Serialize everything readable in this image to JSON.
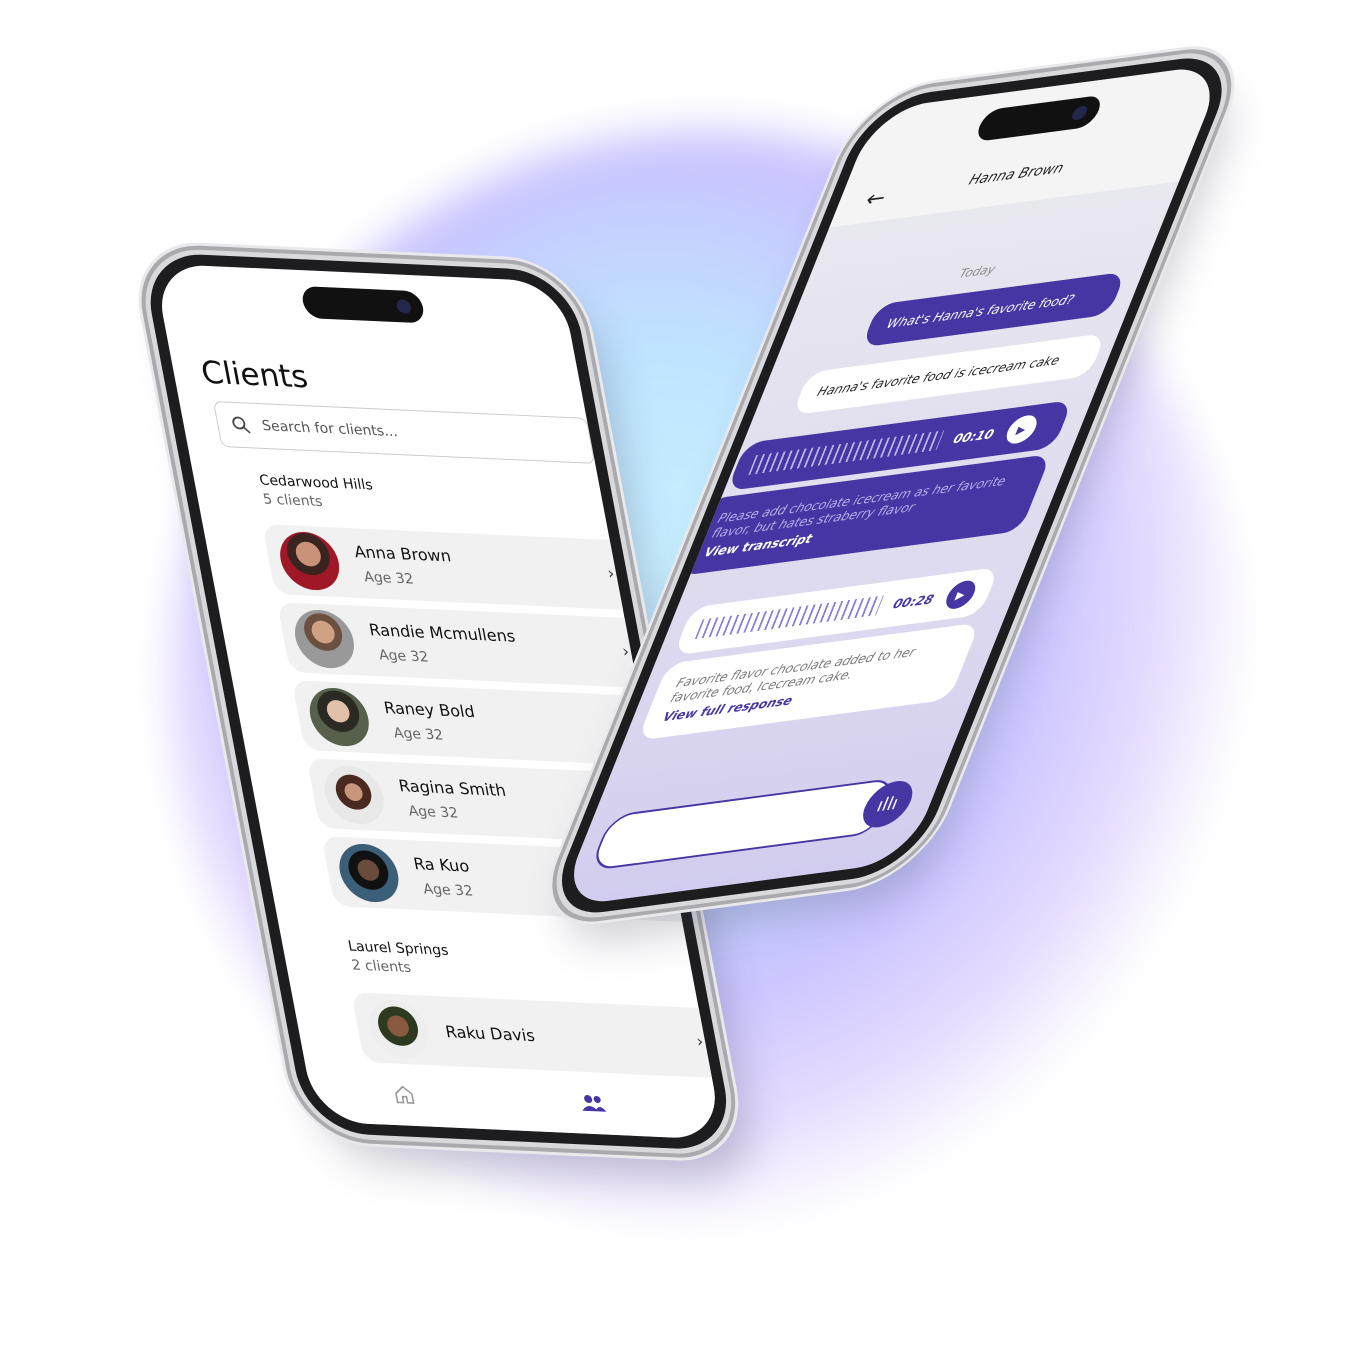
{
  "colors": {
    "accent": "#4536a3",
    "row_bg": "#f1f1f2"
  },
  "clients": {
    "title": "Clients",
    "search_placeholder": "Search for clients...",
    "groups": [
      {
        "name": "Cedarwood Hills",
        "count": "5 clients",
        "clients": [
          {
            "name": "Anna Brown",
            "age": "Age 32"
          },
          {
            "name": "Randie Mcmullens",
            "age": "Age 32"
          },
          {
            "name": "Raney Bold",
            "age": "Age 32"
          },
          {
            "name": "Ragina Smith",
            "age": "Age 32"
          },
          {
            "name": "Ra Kuo",
            "age": "Age 32"
          }
        ]
      },
      {
        "name": "Laurel Springs",
        "count": "2 clients",
        "clients": [
          {
            "name": "Raku Davis",
            "age": ""
          }
        ]
      }
    ],
    "nav": {
      "home_icon": "home-icon",
      "clients_icon": "users-icon"
    }
  },
  "chat": {
    "title": "Hanna Brown",
    "date": "Today",
    "messages": [
      {
        "text": "What's Hanna's favorite food?"
      },
      {
        "text": "Hanna's favorite food is icecream cake"
      },
      {
        "duration": "00:10"
      },
      {
        "text": "Please add chocolate icecream as her favorite flavor, but hates straberry flavor",
        "link": "View transcript"
      },
      {
        "duration": "00:28"
      },
      {
        "text": "Favorite flavor chocolate added to her favorite food, Icecream cake.",
        "link": "View full response"
      }
    ],
    "input_value": ""
  }
}
